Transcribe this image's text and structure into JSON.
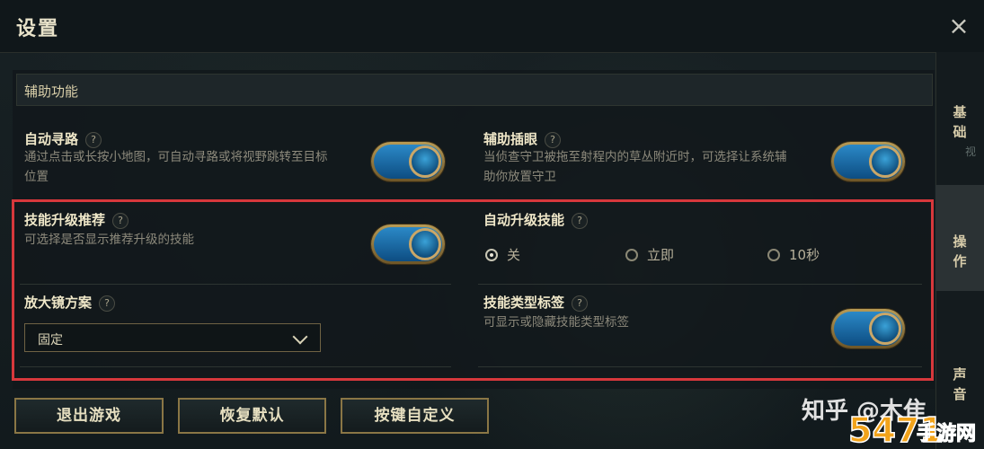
{
  "window": {
    "title": "设置",
    "close_icon": "×"
  },
  "section": {
    "header": "辅助功能"
  },
  "settings": {
    "auto_path": {
      "title": "自动寻路",
      "desc_line1": "通过点击或长按小地图，可自动寻路或将视野跳转至目标",
      "desc_line2": "位置",
      "enabled": true
    },
    "assist_ward": {
      "title": "辅助插眼",
      "desc_line1": "当侦查守卫被拖至射程内的草丛附近时，可选择让系统辅",
      "desc_line2": "助你放置守卫",
      "enabled": true
    },
    "skill_upgrade_recommend": {
      "title": "技能升级推荐",
      "desc": "可选择是否显示推荐升级的技能",
      "enabled": true
    },
    "auto_upgrade_skill": {
      "title": "自动升级技能",
      "options": [
        "关",
        "立即",
        "10秒"
      ],
      "selected": "关"
    },
    "magnifier": {
      "title": "放大镜方案",
      "value": "固定"
    },
    "skill_type_label": {
      "title": "技能类型标签",
      "desc": "可显示或隐藏技能类型标签",
      "enabled": true
    }
  },
  "help_icon": "?",
  "side_tabs": [
    {
      "label": "基础",
      "active": false
    },
    {
      "label": "操作",
      "active": true
    },
    {
      "label": "声音",
      "active": false
    }
  ],
  "side_extra": "视",
  "buttons": {
    "exit_game": "退出游戏",
    "restore_default": "恢复默认",
    "key_custom": "按键自定义"
  },
  "watermark": {
    "text": "知乎 @木隹",
    "logo_text": "手游网",
    "logo_number": "5471"
  },
  "colors": {
    "accent_gold": "#caa768",
    "toggle_blue": "#2b89c7",
    "highlight_red": "#d7383c"
  }
}
